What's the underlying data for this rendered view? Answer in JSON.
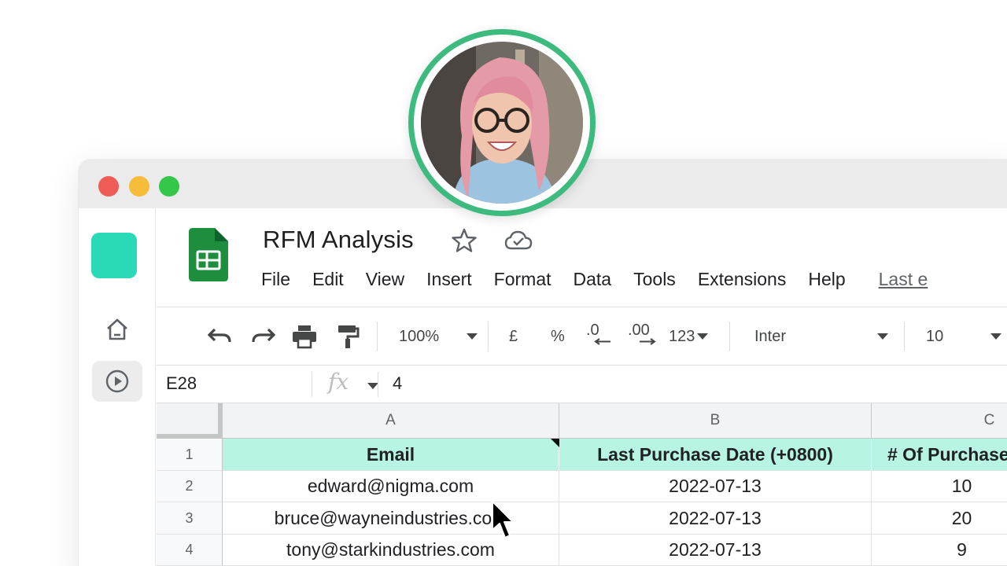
{
  "document": {
    "title": "RFM Analysis",
    "last_edit": "Last e"
  },
  "menu": [
    "File",
    "Edit",
    "View",
    "Insert",
    "Format",
    "Data",
    "Tools",
    "Extensions",
    "Help"
  ],
  "toolbar": {
    "zoom": "100%",
    "currency": "£",
    "percent": "%",
    "decrease_decimal": ".0",
    "increase_decimal": ".00",
    "number_format": "123",
    "font": "Inter",
    "font_size": "10"
  },
  "formula_bar": {
    "cell_ref": "E28",
    "fx": "fx",
    "value": "4"
  },
  "sheet": {
    "columns": [
      "A",
      "B",
      "C"
    ],
    "row_numbers": [
      "1",
      "2",
      "3",
      "4"
    ],
    "rows": [
      [
        "Email",
        "Last Purchase Date (+0800)",
        "# Of Purchases"
      ],
      [
        "edward@nigma.com",
        "2022-07-13",
        "10"
      ],
      [
        "bruce@wayneindustries.com",
        "2022-07-13",
        "20"
      ],
      [
        "tony@starkindustries.com",
        "2022-07-13",
        "9"
      ]
    ]
  },
  "icons": {
    "undo": "undo-icon",
    "redo": "redo-icon",
    "print": "print-icon",
    "paint_format": "paint-format-icon",
    "star": "star-icon",
    "cloud": "cloud-saved-icon",
    "home": "home-icon",
    "play": "play-icon"
  },
  "colors": {
    "header_fill": "#b7f4e3",
    "rail_logo": "#2ad9b5",
    "avatar_ring": "#3dba7e",
    "sheets_green": "#1e8e3e"
  }
}
